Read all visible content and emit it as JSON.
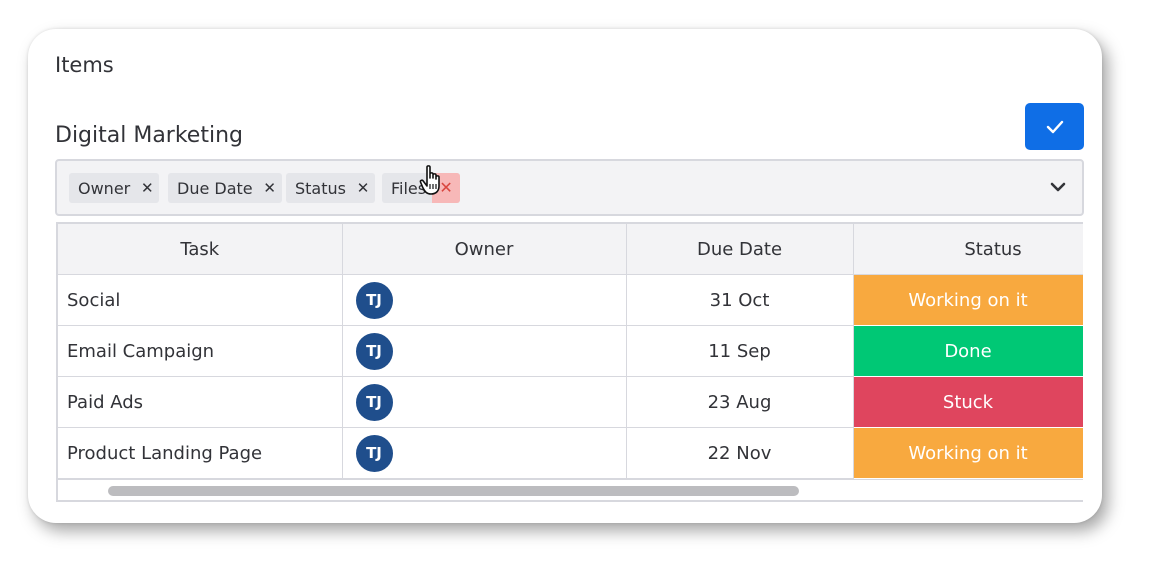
{
  "header": {
    "title": "Items",
    "group_title": "Digital Marketing"
  },
  "filter": {
    "chips": [
      {
        "label": "Owner",
        "remove_icon": "close-icon"
      },
      {
        "label": "Due Date",
        "remove_icon": "close-icon"
      },
      {
        "label": "Status",
        "remove_icon": "close-icon"
      },
      {
        "label": "Files",
        "remove_icon": "close-icon",
        "hovered": true
      }
    ],
    "remove_glyph": "✕",
    "dropdown_icon": "chevron-down-icon"
  },
  "confirm_button": {
    "icon": "checkmark-icon",
    "color": "#0f6ee6"
  },
  "table": {
    "columns": [
      "Task",
      "Owner",
      "Due Date",
      "Status"
    ],
    "rows": [
      {
        "task": "Social",
        "owner": "TJ",
        "due": "31 Oct",
        "status": "Working on it",
        "status_color": "#f8a93f"
      },
      {
        "task": "Email Campaign",
        "owner": "TJ",
        "due": "11 Sep",
        "status": "Done",
        "status_color": "#00c875"
      },
      {
        "task": "Paid Ads",
        "owner": "TJ",
        "due": "23 Aug",
        "status": "Stuck",
        "status_color": "#df455e"
      },
      {
        "task": "Product Landing Page",
        "owner": "TJ",
        "due": "22 Nov",
        "status": "Working on it",
        "status_color": "#f8a93f"
      }
    ]
  },
  "colors": {
    "avatar": "#1f4e8c",
    "accent": "#0f6ee6"
  }
}
